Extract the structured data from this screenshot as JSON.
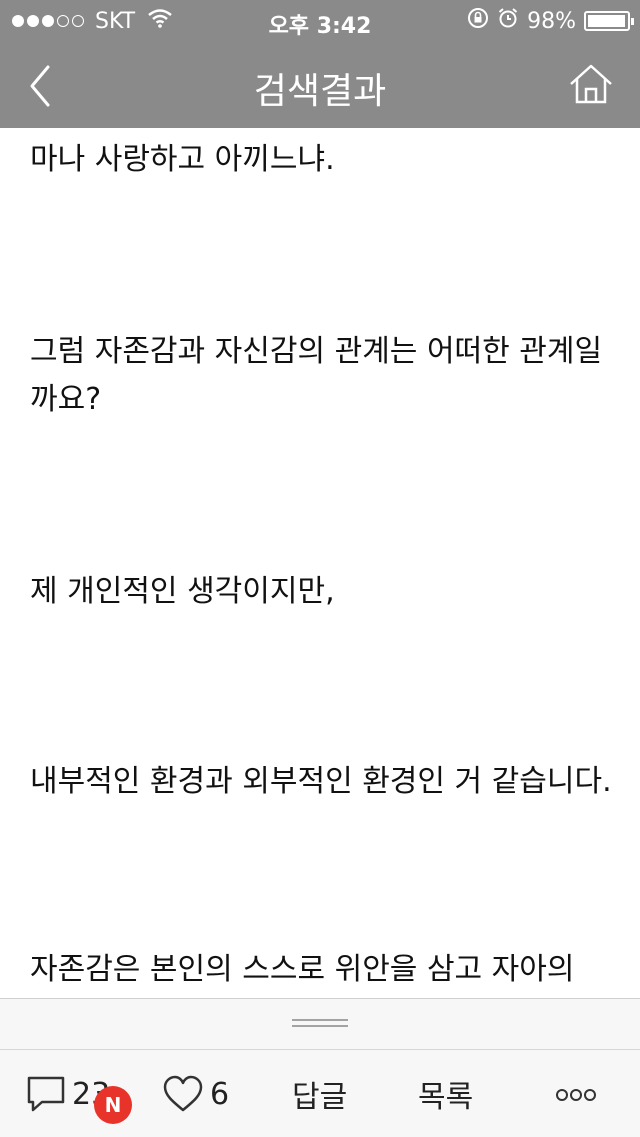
{
  "status_bar": {
    "carrier": "SKT",
    "time": "오후 3:42",
    "battery_percent": "98%",
    "battery_level": 0.98,
    "signal_bars_filled": 3,
    "signal_bars_total": 5,
    "icons": [
      "wifi-icon",
      "orientation-lock-icon",
      "alarm-icon",
      "battery-icon"
    ]
  },
  "nav": {
    "title": "검색결과",
    "back_icon": "chevron-left-icon",
    "home_icon": "home-icon"
  },
  "content": {
    "paragraphs": [
      "마나 사랑하고 아끼느냐.",
      "그럼 자존감과 자신감의 관계는 어떠한 관계일까요?",
      "제 개인적인 생각이지만,",
      "내부적인 환경과 외부적인 환경인 거 같습니다.",
      "자존감은 본인의 스스로 위안을 삼고 자아의"
    ]
  },
  "toolbar": {
    "comment_count": "23",
    "like_count": "6",
    "reply_label": "답글",
    "list_label": "목록",
    "new_badge": "N",
    "icons": [
      "comment-icon",
      "heart-icon",
      "more-icon"
    ]
  },
  "colors": {
    "header_bg": "#8a8a8a",
    "badge": "#e8332a",
    "toolbar_bg": "#f7f7f7"
  }
}
